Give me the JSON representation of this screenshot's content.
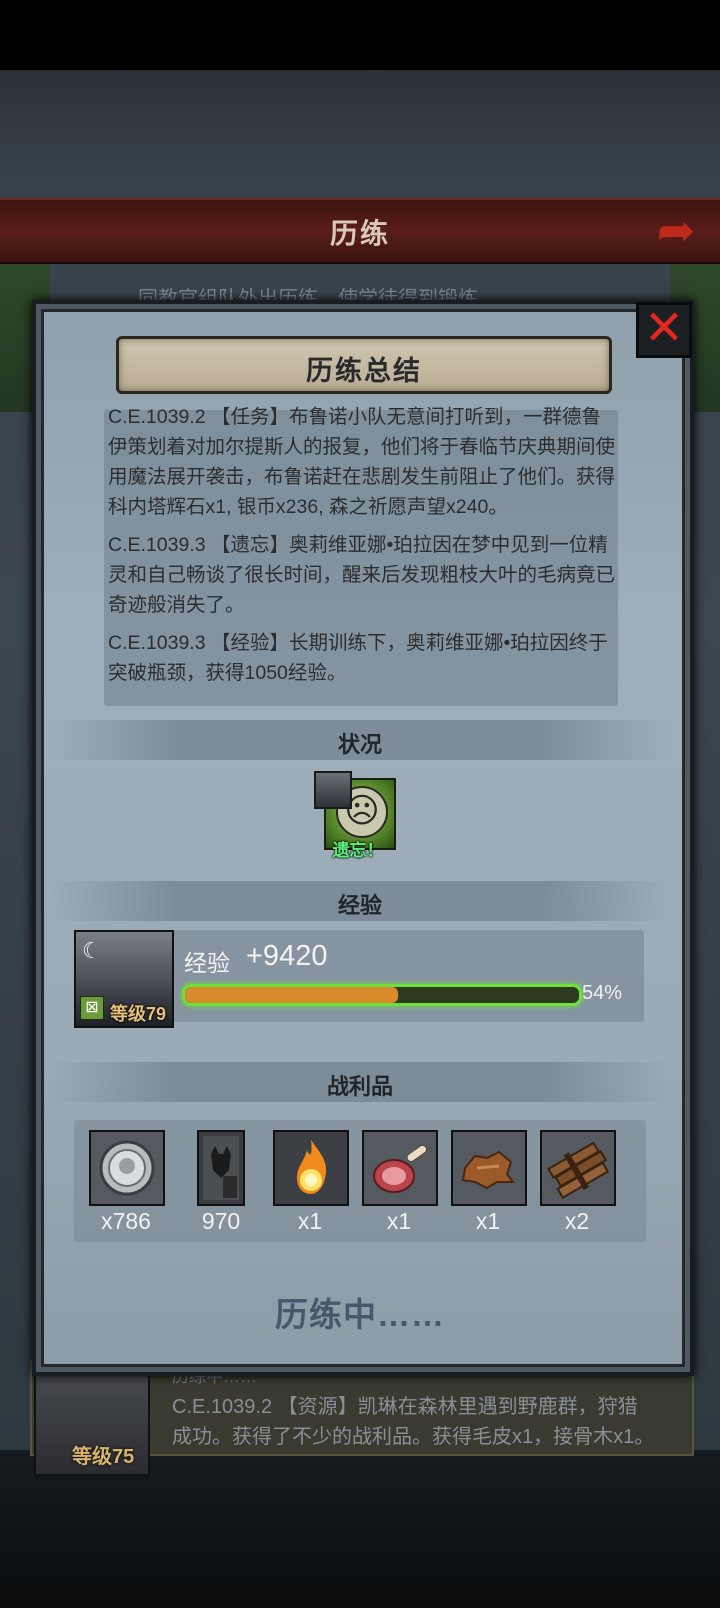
{
  "background": {
    "header_title": "历练",
    "info_text": "同教官组队外出历练，使学徒得到锻炼",
    "lower_card": {
      "header": "历练中……",
      "level": "等级75",
      "log_line1": "C.E.1039.2 【资源】凯琳在森林里遇到野鹿群，狩猎",
      "log_line2": "成功。获得了不少的战利品。获得毛皮x1，接骨木x1。"
    }
  },
  "panel": {
    "title": "历练总结",
    "close_icon": "close-x-icon",
    "logs": [
      "C.E.1039.2 【任务】布鲁诺小队无意间打听到，一群德鲁伊策划着对加尔提斯人的报复，他们将于春临节庆典期间使用魔法展开袭击，布鲁诺赶在悲剧发生前阻止了他们。获得科内塔辉石x1, 银币x236, 森之祈愿声望x240。",
      "C.E.1039.3 【遗忘】奥莉维亚娜•珀拉因在梦中见到一位精灵和自己畅谈了很长时间，醒来后发现粗枝大叶的毛病竟已奇迹般消失了。",
      "C.E.1039.3 【经验】长期训练下，奥莉维亚娜•珀拉因终于突破瓶颈，获得1050经验。"
    ],
    "status": {
      "label": "状况",
      "effect_text": "遗忘！",
      "effect_icon": "sad-face-icon"
    },
    "experience": {
      "label": "经验",
      "row_label": "经验",
      "gain": "+9420",
      "level": "等级79",
      "progress": 0.54,
      "progress_text": "54%",
      "bar_color": "#6ee03a",
      "fill_color": "#d98a2a"
    },
    "loot": {
      "label": "战利品",
      "items": [
        {
          "icon": "silver-coin-icon",
          "count": "x786"
        },
        {
          "icon": "bull-banner-icon",
          "count": "970"
        },
        {
          "icon": "fire-orb-icon",
          "count": "x1"
        },
        {
          "icon": "meat-leg-icon",
          "count": "x1"
        },
        {
          "icon": "fur-pelt-icon",
          "count": "x1"
        },
        {
          "icon": "wood-planks-icon",
          "count": "x2"
        }
      ]
    },
    "footer_status": "历练中……"
  },
  "colors": {
    "close_red": "#e0281e",
    "status_green": "#5cf07a",
    "level_gold": "#e8c27a"
  }
}
